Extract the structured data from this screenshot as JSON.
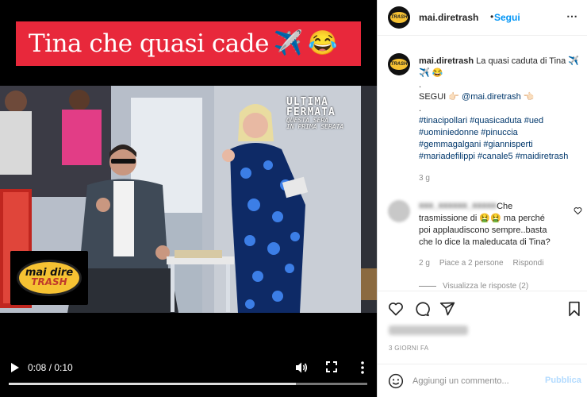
{
  "video": {
    "banner_text": "Tina che quasi cade",
    "banner_emojis": [
      "✈️",
      "😂"
    ],
    "overlay": {
      "line1": "ULTIMA",
      "line2": "FERMATA",
      "line3": "QUESTA SERA",
      "line4": "IN PRIMA SERATA"
    },
    "logo": {
      "line1": "mai dire",
      "line2": "TRASH"
    },
    "time": "0:08 / 0:10",
    "progress": 0.8
  },
  "header": {
    "username": "mai.diretrash",
    "separator": "•",
    "follow_label": "Segui",
    "more_icon": "⋯"
  },
  "caption": {
    "username": "mai.diretrash",
    "text": "La quasi caduta di Tina ✈️ ✈️ 😂",
    "dot1": ".",
    "segui": "SEGUI 👉🏻",
    "mention": "@mai.diretrash",
    "mention_end": "👈🏻",
    "dot2": ".",
    "hashtags": "#tinacipollari #quasicaduta #ued #uominiedonne #pinuccia #gemmagalgani #giannisperti #mariadefilippi #canale5 #maidiretrash",
    "time": "3 g"
  },
  "comment": {
    "username": "xxx_xxxxxx_xxxxx",
    "text": "Che trasmissione di 🤮🤮 ma perché poi applaudiscono sempre..basta che lo dice la maleducata di Tina?",
    "time": "2 g",
    "likes": "Piace a 2 persone",
    "reply": "Rispondi",
    "view_replies": "Visualizza le risposte (2)"
  },
  "likes_blurred": "Piace a jnsxxx e altri",
  "post_date": "3 GIORNI FA",
  "comment_box": {
    "placeholder": "Aggiungi un commento...",
    "publish": "Pubblica"
  }
}
